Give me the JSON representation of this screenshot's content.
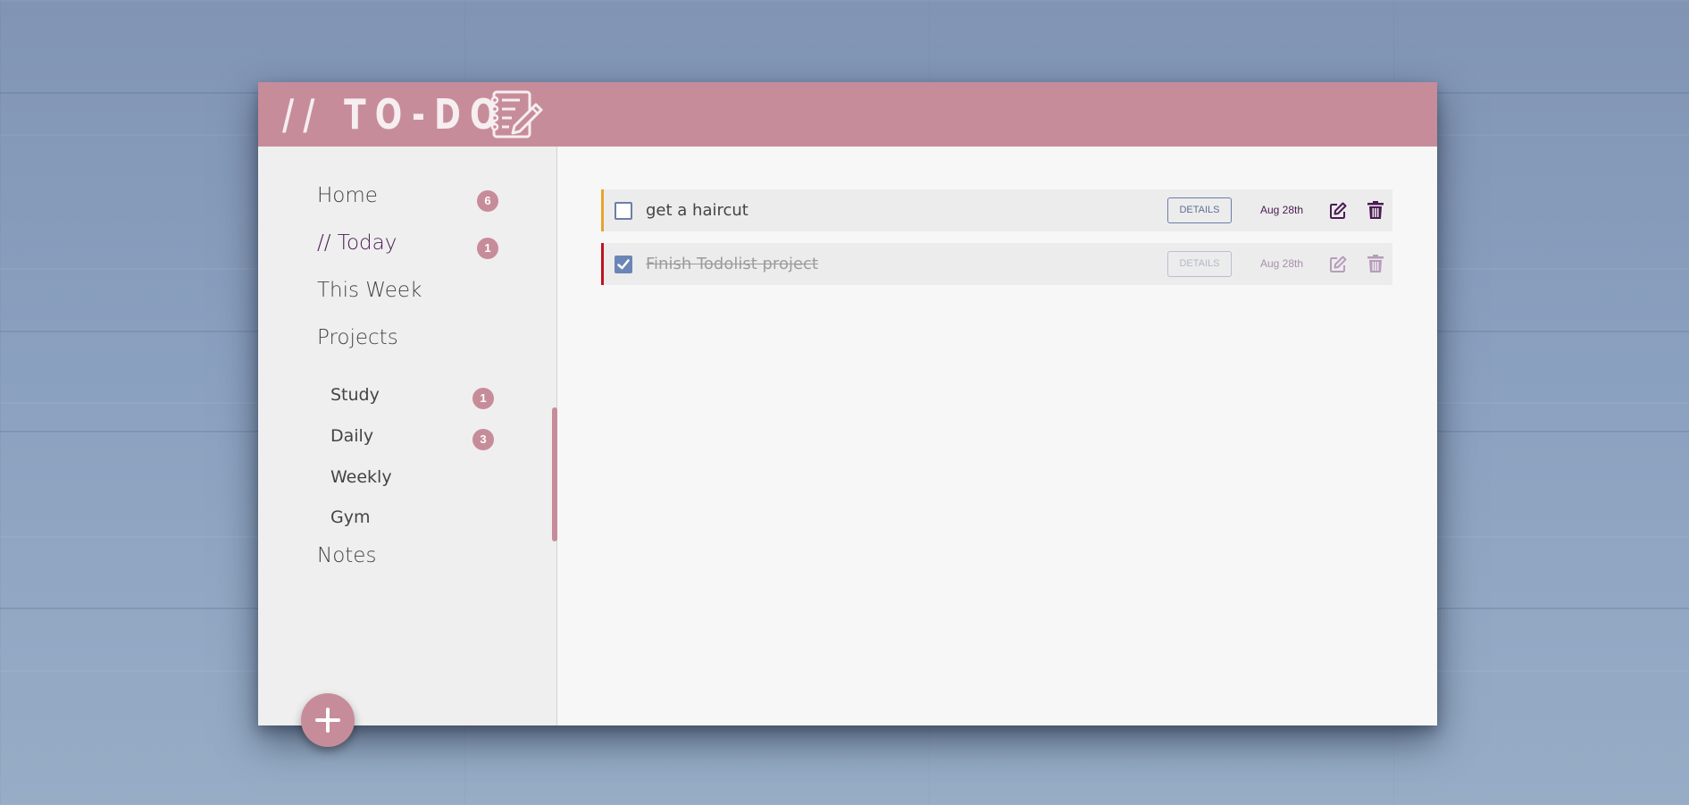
{
  "header": {
    "logo_text": "// TO-DO",
    "logo_icon": "checklist-pencil-icon"
  },
  "colors": {
    "accent": "#c78c9a",
    "active_text": "#4b1b54",
    "priority_medium": "#e3a62b",
    "priority_high": "#c1121f",
    "checkbox": "#6b86b6"
  },
  "sidebar": {
    "nav": [
      {
        "label": "Home",
        "count": "6"
      },
      {
        "label": "// Today",
        "count": "1",
        "active": true
      },
      {
        "label": "This Week"
      },
      {
        "label": "Projects"
      }
    ],
    "projects": [
      {
        "label": "Study",
        "count": "1"
      },
      {
        "label": "Daily",
        "count": "3"
      },
      {
        "label": "Weekly"
      },
      {
        "label": "Gym"
      }
    ],
    "notes_label": "Notes",
    "add_button_icon": "plus-icon"
  },
  "todos": [
    {
      "title": "get a haircut",
      "details_label": "DETAILS",
      "date": "Aug 28th",
      "completed": false,
      "priority": "medium"
    },
    {
      "title": "Finish Todolist project",
      "details_label": "DETAILS",
      "date": "Aug 28th",
      "completed": true,
      "priority": "high"
    }
  ]
}
